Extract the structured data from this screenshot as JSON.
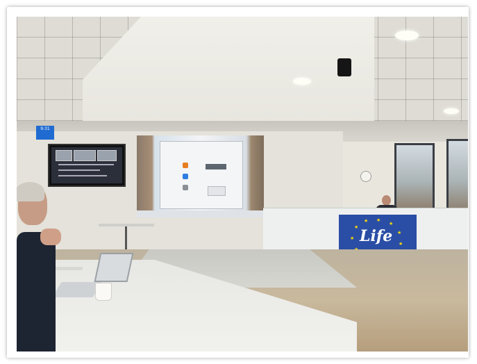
{
  "scene": {
    "wall_clock_text": "9:31",
    "flag_text": "Life",
    "colors": {
      "flag_blue": "#2a4ea6",
      "flag_star": "#ffdd00",
      "clock_blue": "#1f6bd1"
    }
  }
}
